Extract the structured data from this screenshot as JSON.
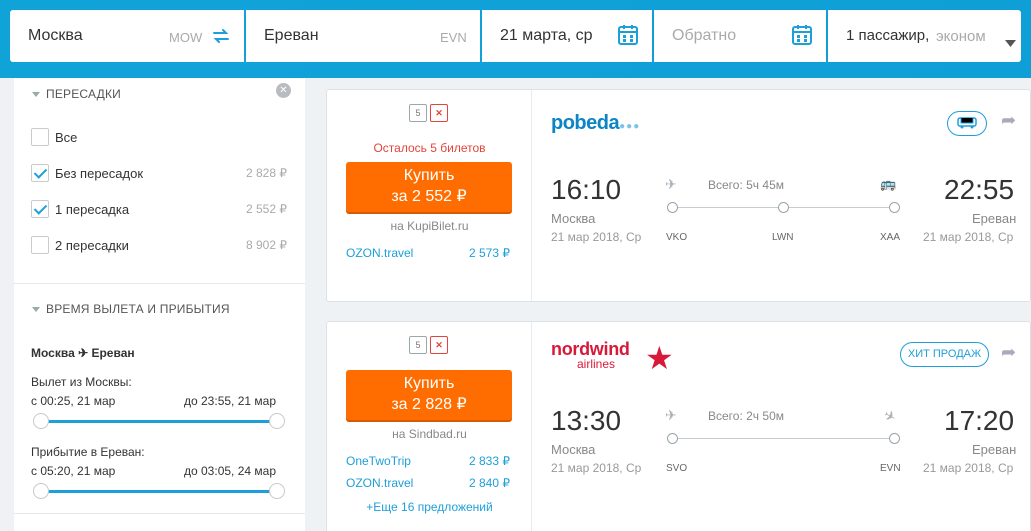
{
  "search": {
    "from": {
      "city": "Москва",
      "code": "MOW"
    },
    "to": {
      "city": "Ереван",
      "code": "EVN"
    },
    "depart_date": "21 марта, ср",
    "return_placeholder": "Обратно",
    "passengers": "1 пассажир,",
    "cabin": "эконом"
  },
  "filters": {
    "stops_title": "ПЕРЕСАДКИ",
    "options": [
      {
        "label": "Все",
        "price": "",
        "checked": false
      },
      {
        "label": "Без пересадок",
        "price": "2 828 ₽",
        "checked": true
      },
      {
        "label": "1 пересадка",
        "price": "2 552 ₽",
        "checked": true
      },
      {
        "label": "2 пересадки",
        "price": "8 902 ₽",
        "checked": false
      }
    ],
    "time_title": "ВРЕМЯ ВЫЛЕТА И ПРИБЫТИЯ",
    "route": "Москва ✈ Ереван",
    "departure": {
      "label": "Вылет из Москвы:",
      "from": "с 00:25, 21 мар",
      "to": "до 23:55, 21 мар"
    },
    "arrival": {
      "label": "Прибытие в Ереван:",
      "from": "с 05:20, 21 мар",
      "to": "до 03:05, 24 мар"
    }
  },
  "results": [
    {
      "tickets_left": "Осталось 5 билетов",
      "baggage_weight": "5",
      "buy_label": "Купить",
      "buy_price": "за 2 552 ₽",
      "agency": "на KupiBilet.ru",
      "alternatives": [
        {
          "name": "OZON.travel",
          "price": "2 573 ₽"
        }
      ],
      "airline": "pobeda",
      "dep_time": "16:10",
      "dep_city": "Москва",
      "dep_date": "21 мар 2018, Ср",
      "arr_time": "22:55",
      "arr_city": "Ереван",
      "arr_date": "21 мар 2018, Ср",
      "duration": "Всего: 5ч 45м",
      "airports": [
        "VKO",
        "LWN",
        "XAA"
      ]
    },
    {
      "baggage_weight": "5",
      "buy_label": "Купить",
      "buy_price": "за 2 828 ₽",
      "agency": "на Sindbad.ru",
      "alternatives": [
        {
          "name": "OneTwoTrip",
          "price": "2 833 ₽"
        },
        {
          "name": "OZON.travel",
          "price": "2 840 ₽"
        }
      ],
      "more_offers": "+Еще 16 предложений",
      "airline_top": "nordwind",
      "airline_bottom": "airlines",
      "badge": "ХИТ ПРОДАЖ",
      "dep_time": "13:30",
      "dep_city": "Москва",
      "dep_date": "21 мар 2018, Ср",
      "arr_time": "17:20",
      "arr_city": "Ереван",
      "arr_date": "21 мар 2018, Ср",
      "duration": "Всего: 2ч 50м",
      "airports": [
        "SVO",
        "EVN"
      ]
    }
  ],
  "colors": {
    "header": "#10a3d8",
    "accent": "#1d9fd9",
    "buy": "#ff6d00",
    "warn": "#e2453c",
    "nordwind": "#d7193a",
    "pobeda": "#0c85c7"
  }
}
